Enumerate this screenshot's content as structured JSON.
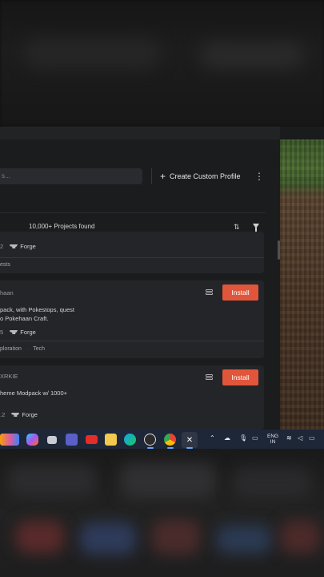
{
  "search": {
    "placeholder": "s..."
  },
  "header": {
    "create_profile_label": "Create Custom Profile",
    "kebab": "⋮"
  },
  "results": {
    "count_label": "10,000+ Projects found"
  },
  "cards": [
    {
      "version_partial": "2",
      "loader": "Forge",
      "tags": [
        "ests"
      ]
    },
    {
      "author_partial": "haan",
      "description_line1": "pack, with Pokestops, quest",
      "description_line2": "o Pokehaan Craft.",
      "version_partial": "5",
      "loader": "Forge",
      "tags": [
        "ploration",
        "Tech"
      ],
      "install_label": "Install"
    },
    {
      "author_partial": "XRKIE",
      "description_line1": "heme Modpack w/ 1000+",
      "version_partial": ".2",
      "loader": "Forge",
      "install_label": "Install"
    }
  ],
  "taskbar": {
    "icons": [
      "widgets-icon",
      "copilot-icon",
      "task-view-icon",
      "teams-icon",
      "youtube-icon",
      "file-explorer-icon",
      "edge-icon",
      "obs-icon",
      "chrome-icon",
      "curseforge-icon"
    ],
    "lang_line1": "ENG",
    "lang_line2": "IN"
  },
  "colors": {
    "accent": "#e1563b",
    "taskbar": "#1e2738",
    "panel": "#1b1c1e",
    "card": "#242528"
  }
}
